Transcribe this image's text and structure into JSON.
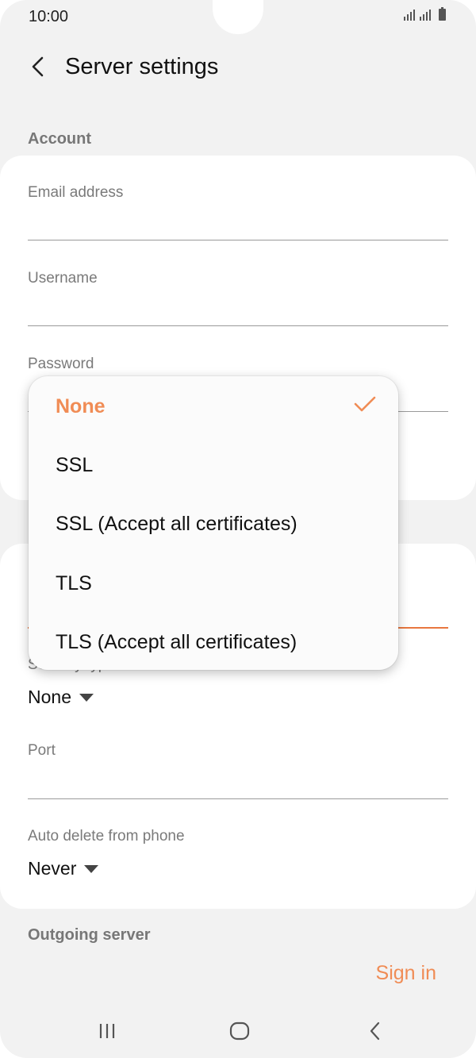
{
  "status": {
    "time": "10:00"
  },
  "header": {
    "title": "Server settings"
  },
  "account": {
    "section_title": "Account",
    "email_label": "Email address",
    "email_value": "",
    "username_label": "Username",
    "username_value": "",
    "password_label": "Password"
  },
  "incoming": {
    "security_type_label": "Security type",
    "security_type_value": "None",
    "port_label": "Port",
    "port_value": "",
    "auto_delete_label": "Auto delete from phone",
    "auto_delete_value": "Never"
  },
  "outgoing": {
    "section_title": "Outgoing server"
  },
  "actions": {
    "sign_in": "Sign in"
  },
  "dropdown": {
    "options": [
      {
        "label": "None",
        "selected": true
      },
      {
        "label": "SSL",
        "selected": false
      },
      {
        "label": "SSL (Accept all certificates)",
        "selected": false
      },
      {
        "label": "TLS",
        "selected": false
      },
      {
        "label": "TLS (Accept all certificates)",
        "selected": false
      }
    ]
  },
  "colors": {
    "accent": "#f08c55",
    "background": "#f2f2f2",
    "card": "#ffffff"
  },
  "icons": {
    "back": "chevron-left-icon",
    "check": "check-icon",
    "recents": "recents-icon",
    "home": "home-icon",
    "nav_back": "nav-back-icon"
  }
}
